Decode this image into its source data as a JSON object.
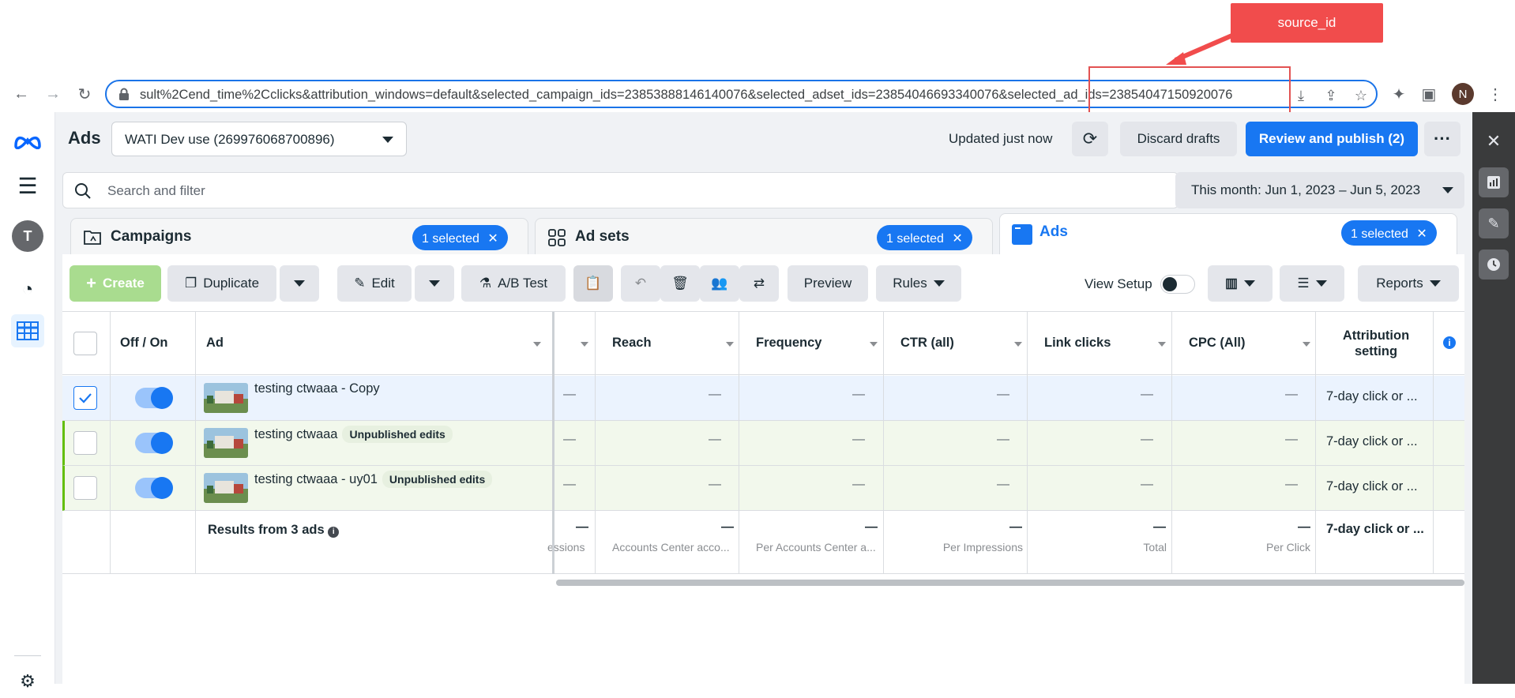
{
  "annotation": {
    "label": "source_id"
  },
  "browser": {
    "url": "sult%2Cend_time%2Cclicks&attribution_windows=default&selected_campaign_ids=23853888146140076&selected_adset_ids=23854046693340076&selected_ad_ids=23854047150920076",
    "profile_initial": "N"
  },
  "header": {
    "title": "Ads",
    "account": "WATI Dev use (269976068700896)",
    "updated": "Updated just now",
    "discard": "Discard drafts",
    "publish": "Review and publish (2)",
    "rail_avatar": "T"
  },
  "search": {
    "placeholder": "Search and filter",
    "date_range": "This month: Jun 1, 2023 – Jun 5, 2023"
  },
  "level_tabs": [
    {
      "label": "Campaigns",
      "selected": "1 selected"
    },
    {
      "label": "Ad sets",
      "selected": "1 selected"
    },
    {
      "label": "Ads",
      "selected": "1 selected"
    }
  ],
  "toolbar": {
    "create": "Create",
    "duplicate": "Duplicate",
    "edit": "Edit",
    "ab_test": "A/B Test",
    "preview": "Preview",
    "rules": "Rules",
    "view_setup": "View Setup",
    "reports": "Reports"
  },
  "table": {
    "headers": {
      "onoff": "Off / On",
      "ad": "Ad",
      "reach": "Reach",
      "frequency": "Frequency",
      "ctr": "CTR (all)",
      "link_clicks": "Link clicks",
      "cpc": "CPC (All)",
      "attribution": "Attribution setting"
    },
    "rows": [
      {
        "name": "testing ctwaaa - Copy",
        "badge": "",
        "checked": true,
        "attribution": "7-day click or ...",
        "dash": "—"
      },
      {
        "name": "testing ctwaaa",
        "badge": "Unpublished edits",
        "checked": false,
        "attribution": "7-day click or ...",
        "dash": "—"
      },
      {
        "name": "testing ctwaaa - uy01",
        "badge": "Unpublished edits",
        "checked": false,
        "attribution": "7-day click or ...",
        "dash": "—"
      }
    ],
    "footer": {
      "label": "Results from 3 ads",
      "dash": "—",
      "impressions_sub": "essions",
      "reach_sub": "Accounts Center acco...",
      "frequency_sub": "Per Accounts Center a...",
      "ctr_sub": "Per Impressions",
      "link_sub": "Total",
      "cpc_sub": "Per Click",
      "attribution": "7-day click or ..."
    }
  },
  "colors": {
    "brand_blue": "#1877f2",
    "annotation_red": "#f14c4c",
    "unpublished_row": "#f2f8ec",
    "selected_row": "#ebf3fe"
  }
}
